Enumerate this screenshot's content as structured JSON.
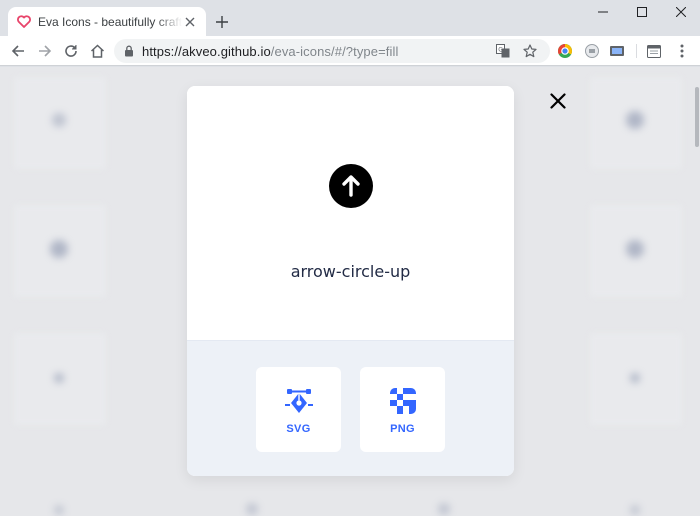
{
  "browser": {
    "tab_title": "Eva Icons - beautifully crafted Open Source icons",
    "url_host": "https://akveo.github.io",
    "url_path": "/eva-icons/#/?type=fill"
  },
  "modal": {
    "icon_name": "arrow-circle-up",
    "buttons": [
      {
        "label": "SVG",
        "icon": "svg-pen-icon"
      },
      {
        "label": "PNG",
        "icon": "png-checker-icon"
      }
    ]
  },
  "colors": {
    "accent": "#3366ff",
    "icon": "#000000",
    "modal_footer": "#edf1f7"
  }
}
